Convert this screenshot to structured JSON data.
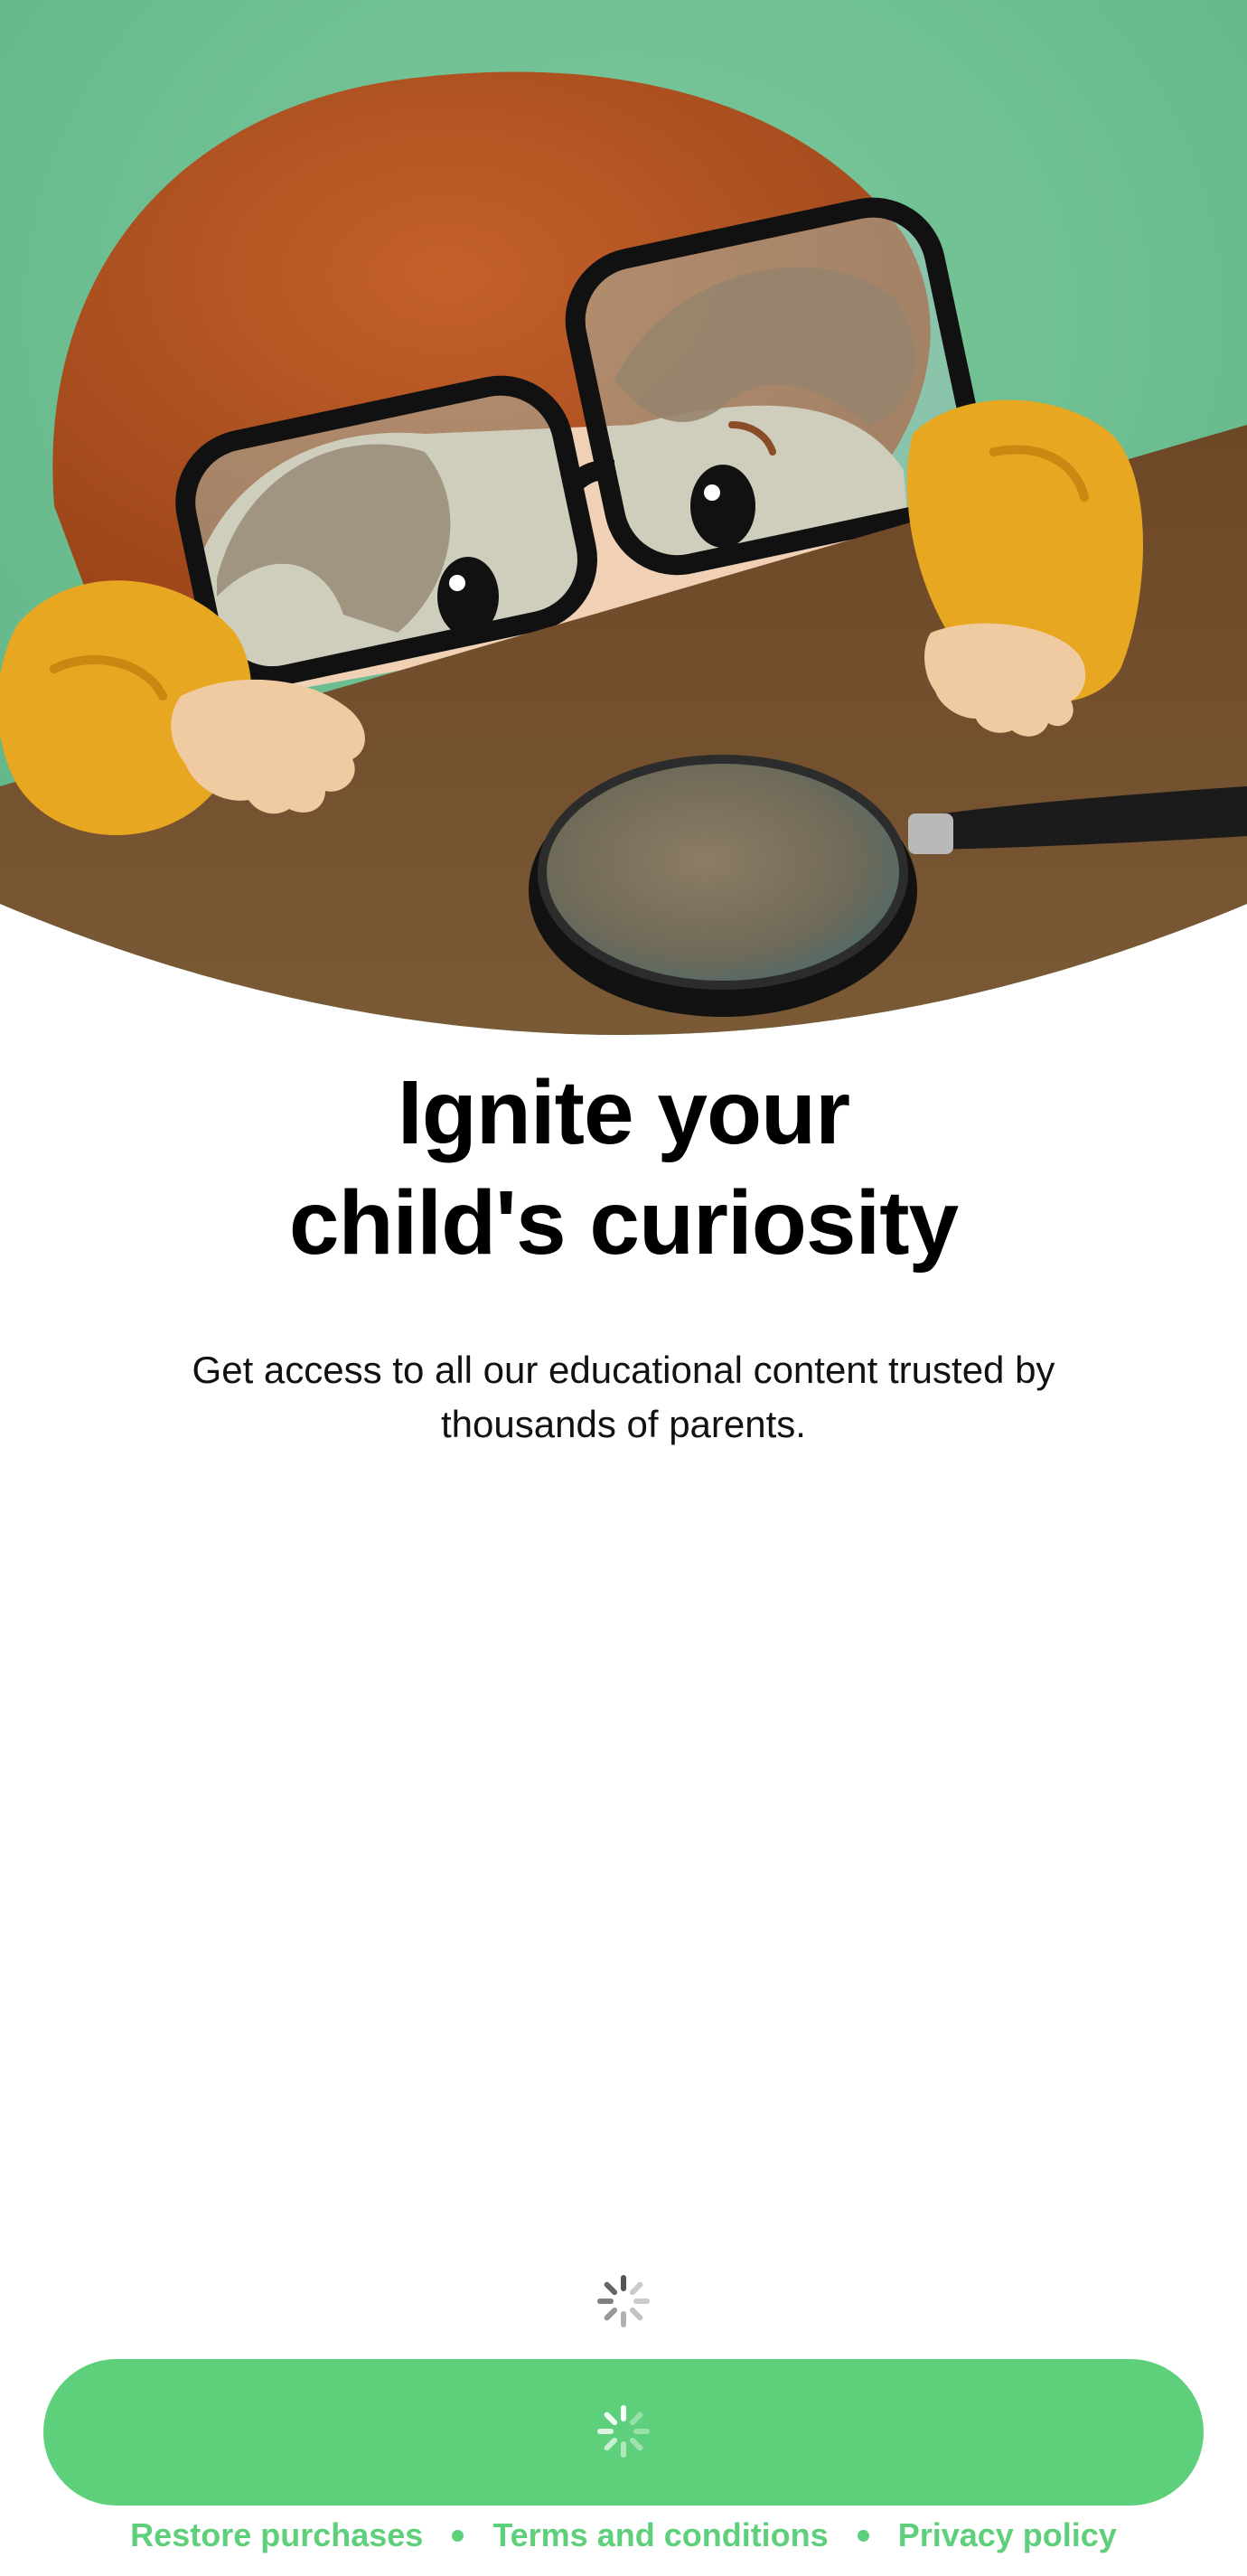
{
  "headline": {
    "line1": "Ignite your",
    "line2": "child's curiosity"
  },
  "subtitle": "Get access to all our educational content trusted by thousands of parents.",
  "status": {
    "loading": true
  },
  "cta": {
    "state": "loading"
  },
  "footer": {
    "restore_label": "Restore purchases",
    "terms_label": "Terms and conditions",
    "privacy_label": "Privacy policy"
  },
  "colors": {
    "accent": "#5ed07b",
    "background_green": "#6cbf91",
    "table_brown": "#6a4424",
    "sleeve_yellow": "#e8a721",
    "hair_orange": "#b4531d"
  },
  "icons": [
    "loading-spinner-icon",
    "magnifying-glass-illustration",
    "dot-separator-icon"
  ]
}
